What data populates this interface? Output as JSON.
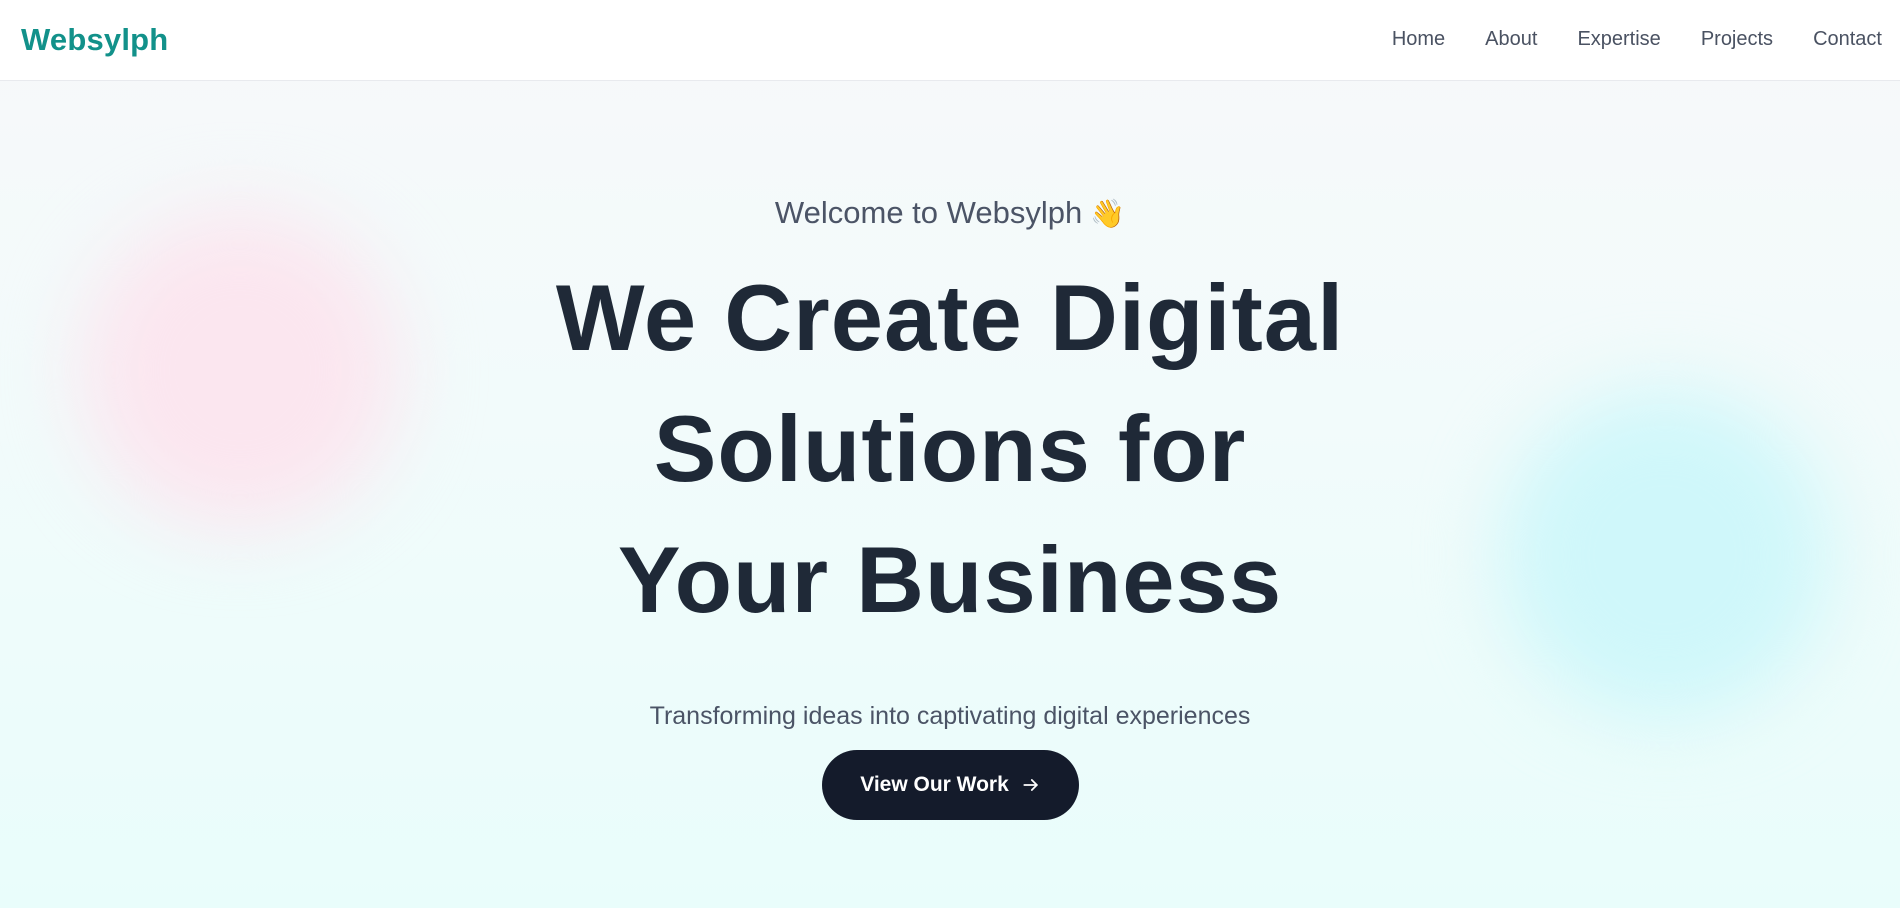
{
  "brand": {
    "name": "Websylph"
  },
  "nav": {
    "items": [
      {
        "label": "Home"
      },
      {
        "label": "About"
      },
      {
        "label": "Expertise"
      },
      {
        "label": "Projects"
      },
      {
        "label": "Contact"
      }
    ]
  },
  "hero": {
    "welcome": "Welcome to Websylph",
    "wave_emoji": "👋",
    "headline_lines": [
      "We Create Digital",
      "Solutions for",
      "Your Business"
    ],
    "subtitle": "Transforming ideas into captivating digital experiences",
    "cta_label": "View Our Work",
    "cta_icon": "arrow-right-icon"
  },
  "colors": {
    "brand": "#12918a",
    "headline": "#1f2937",
    "body_text": "#4b5466",
    "cta_background": "#141b2b",
    "blob_pink": "#fbe6ef",
    "blob_cyan": "#cff7fa"
  }
}
